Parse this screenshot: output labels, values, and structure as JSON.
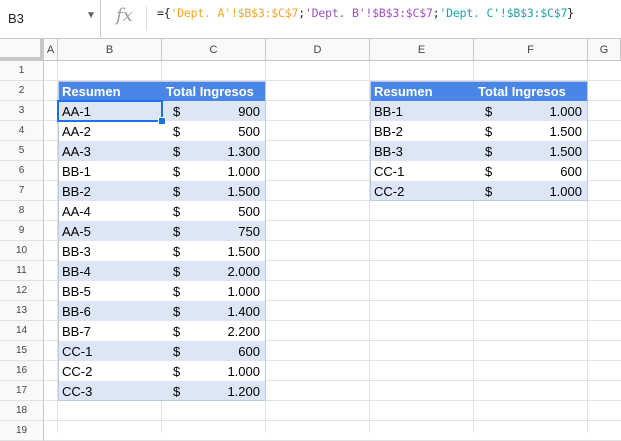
{
  "toolbar": {
    "name_box": "B3",
    "fx_label": "fx",
    "formula": {
      "start": "={",
      "part_a": "'Dept. A'!$B$3:$C$7",
      "sep1": ";",
      "part_b": "'Dept. B'!$B$3:$C$7",
      "sep2": ";",
      "part_c": "'Dept. C'!$B$3:$C$7",
      "end": "}"
    }
  },
  "columns": [
    "A",
    "B",
    "C",
    "D",
    "E",
    "F",
    "G"
  ],
  "rows": [
    "1",
    "2",
    "3",
    "4",
    "5",
    "6",
    "7",
    "8",
    "9",
    "10",
    "11",
    "12",
    "13",
    "14",
    "15",
    "16",
    "17",
    "18",
    "19"
  ],
  "table_left": {
    "header": [
      "Resumen",
      "Total Ingresos"
    ],
    "rows": [
      [
        "AA-1",
        "$",
        "900"
      ],
      [
        "AA-2",
        "$",
        "500"
      ],
      [
        "AA-3",
        "$",
        "1.300"
      ],
      [
        "BB-1",
        "$",
        "1.000"
      ],
      [
        "BB-2",
        "$",
        "1.500"
      ],
      [
        "AA-4",
        "$",
        "500"
      ],
      [
        "AA-5",
        "$",
        "750"
      ],
      [
        "BB-3",
        "$",
        "1.500"
      ],
      [
        "BB-4",
        "$",
        "2.000"
      ],
      [
        "BB-5",
        "$",
        "1.000"
      ],
      [
        "BB-6",
        "$",
        "1.400"
      ],
      [
        "BB-7",
        "$",
        "2.200"
      ],
      [
        "CC-1",
        "$",
        "600"
      ],
      [
        "CC-2",
        "$",
        "1.000"
      ],
      [
        "CC-3",
        "$",
        "1.200"
      ]
    ]
  },
  "table_right": {
    "header": [
      "Resumen",
      "Total Ingresos"
    ],
    "rows": [
      [
        "BB-1",
        "$",
        "1.000"
      ],
      [
        "BB-2",
        "$",
        "1.500"
      ],
      [
        "BB-3",
        "$",
        "1.500"
      ],
      [
        "CC-1",
        "$",
        "600"
      ],
      [
        "CC-2",
        "$",
        "1.000"
      ]
    ]
  },
  "colors": {
    "header_bg": "#4a86e8",
    "band_bg": "#dce6f5",
    "selection": "#1a73e8"
  }
}
